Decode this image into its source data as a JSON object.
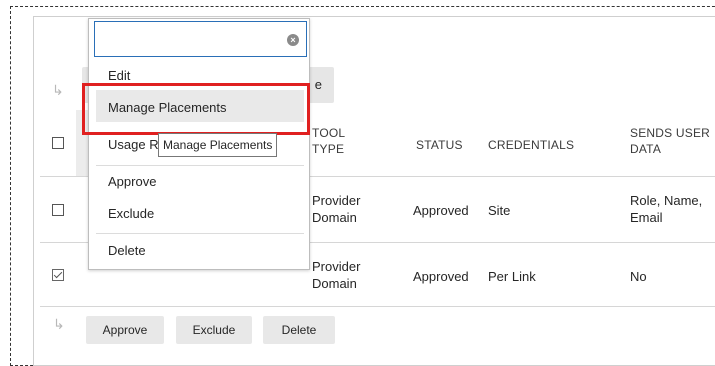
{
  "top_bar": {
    "partial_button_label": "e"
  },
  "table": {
    "headers": {
      "tool_type": "TOOL\nTYPE",
      "status": "STATUS",
      "credentials": "CREDENTIALS",
      "sends_user_data": "SENDS USER\nDATA"
    },
    "rows": [
      {
        "checked": false,
        "tool_type": "Provider\nDomain",
        "status": "Approved",
        "credentials": "Site",
        "sends_user_data": "Role, Name,\nEmail"
      },
      {
        "checked": true,
        "tool_type": "Provider\nDomain",
        "status": "Approved",
        "credentials": "Per Link",
        "sends_user_data": "No"
      }
    ]
  },
  "bottom_bar": {
    "approve": "Approve",
    "exclude": "Exclude",
    "delete": "Delete"
  },
  "menu": {
    "search_value": "",
    "items": {
      "edit": "Edit",
      "manage_placements": "Manage Placements",
      "usage": "Usage R",
      "approve": "Approve",
      "exclude": "Exclude",
      "delete": "Delete"
    },
    "tooltip": "Manage Placements"
  },
  "colors": {
    "focus_outline": "#e02020",
    "search_border": "#2a6fb7",
    "row_highlight": "#e9e9e9"
  }
}
